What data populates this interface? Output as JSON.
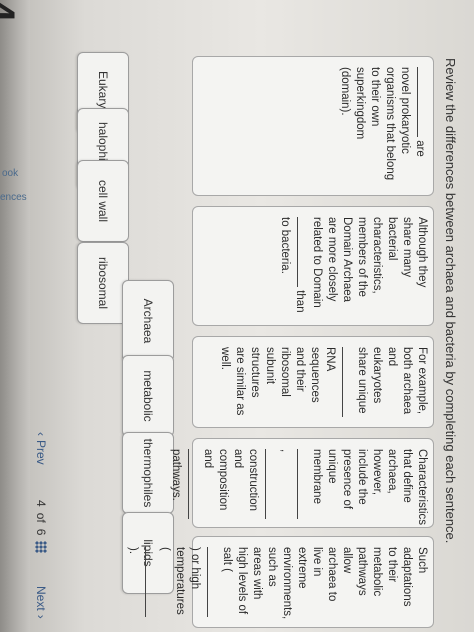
{
  "question": {
    "number": "4",
    "instructions": "Review the differences between archaea and bacteria by completing each sentence."
  },
  "left_edge": {
    "text1": "ook",
    "text2": "ences"
  },
  "tiles_left": [
    "Eukarya",
    "halophiles",
    "cell wall",
    "ribosomal",
    "Archaea",
    "metabolic",
    "thermophiles",
    "lipids"
  ],
  "sentences": [
    {
      "pre": "",
      "post": "are novel prokaryotic organisms that belong to their own superkingdom (domain)."
    },
    {
      "pre": "Although they share many bacterial characteristics, members of the Domain Archaea are more closely related to Domain",
      "post": "than to bacteria."
    },
    {
      "pre": "For example, both archaea and eukaryotes share unique",
      "post": "RNA sequences and their ribosomal subunit structures are similar as well."
    },
    {
      "pre": "Characteristics that define archaea, however, include the presence of unique membrane",
      "mid": ",",
      "mid2": "construction and composition and",
      "post": "pathways."
    },
    {
      "pre": "Such adaptations to their metabolic pathways allow archaea to live in extreme environments, such as areas with high levels of salt (",
      "mid": ") or high temperatures (",
      "post": ")."
    }
  ],
  "footer": {
    "prev_label": "Prev",
    "page_current": "4",
    "page_sep": "of",
    "page_total": "6",
    "next_label": "Next"
  }
}
